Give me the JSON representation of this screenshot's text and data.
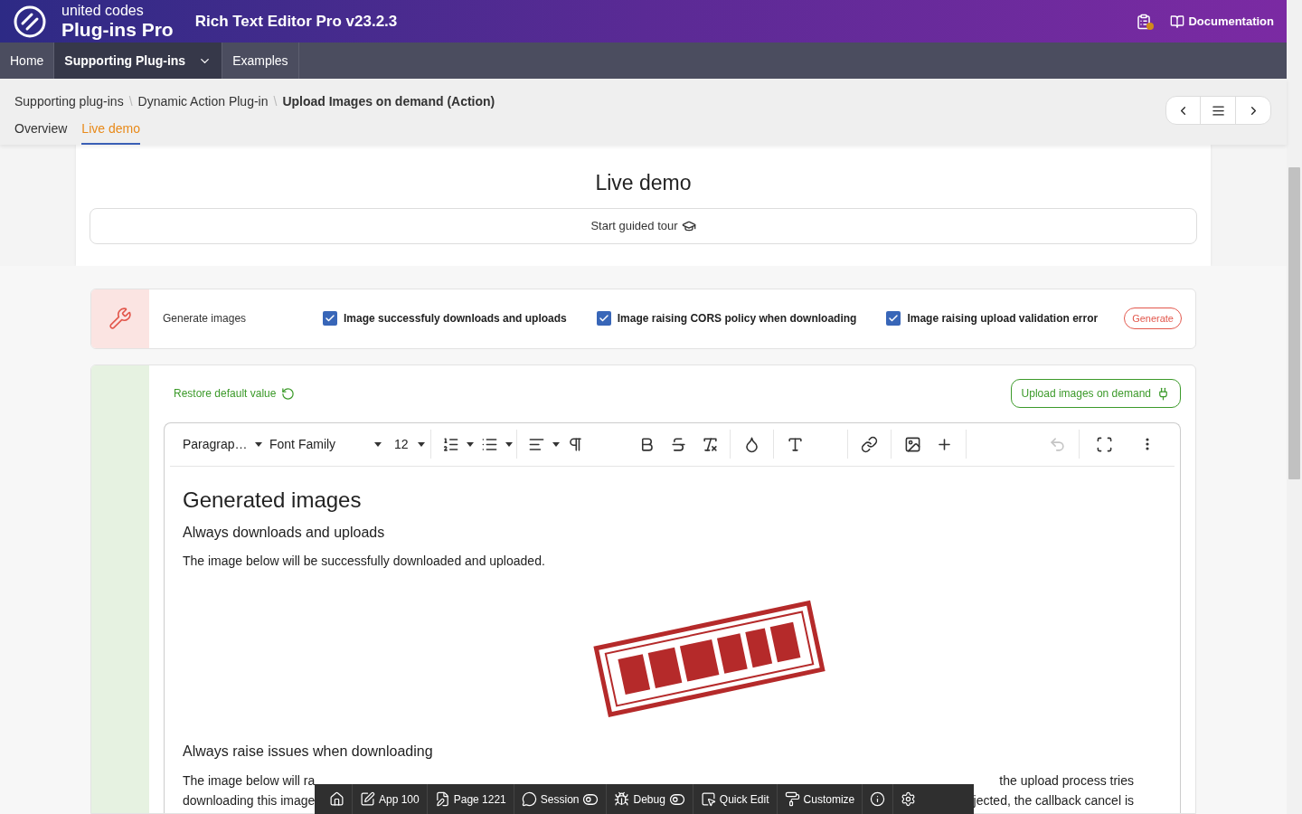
{
  "header": {
    "brand_top": "united codes",
    "brand_bottom": "Plug-ins Pro",
    "title": "Rich Text Editor Pro v23.2.3",
    "doc_link": "Documentation"
  },
  "nav": [
    {
      "label": "Home",
      "selected": false,
      "dropdown": false
    },
    {
      "label": "Supporting Plug-ins",
      "selected": true,
      "dropdown": true
    },
    {
      "label": "Examples",
      "selected": false,
      "dropdown": false
    }
  ],
  "breadcrumb": {
    "separator": "\\",
    "items": [
      "Supporting plug-ins",
      "Dynamic Action Plug-in",
      "Upload Images on demand (Action)"
    ]
  },
  "tabs": [
    {
      "label": "Overview",
      "selected": false
    },
    {
      "label": "Live demo",
      "selected": true
    }
  ],
  "page_title": "Live demo",
  "tour_button": "Start guided tour",
  "generate_panel": {
    "label": "Generate images",
    "button": "Generate",
    "options": [
      {
        "label": "Image successfuly downloads and uploads",
        "checked": true
      },
      {
        "label": "Image raising CORS policy when downloading",
        "checked": true
      },
      {
        "label": "Image raising upload validation error",
        "checked": true
      }
    ]
  },
  "editor_panel": {
    "restore": "Restore default value",
    "upload_button": "Upload images on demand",
    "toolbar": {
      "block_format": "Paragrap…",
      "font_family": "Font Family",
      "font_size": "12",
      "undo_disabled": true
    },
    "content": [
      {
        "kind": "h1",
        "text": "Generated images"
      },
      {
        "kind": "h2",
        "text": "Always downloads and uploads"
      },
      {
        "kind": "p",
        "text": "The image below will be successfully downloaded and uploaded."
      },
      {
        "kind": "picture"
      },
      {
        "kind": "h2",
        "text": "Always raise issues when downloading"
      },
      {
        "kind": "split",
        "lines": [
          [
            "The image below will ra",
            "the upload process tries"
          ],
          [
            "downloading this image",
            "jected, the callback cancel is"
          ]
        ]
      }
    ]
  },
  "dev_toolbar": [
    {
      "kind": "home"
    },
    {
      "kind": "app",
      "label": "App 100"
    },
    {
      "kind": "page",
      "label": "Page 1221"
    },
    {
      "kind": "session",
      "label": "Session"
    },
    {
      "kind": "debug",
      "label": "Debug"
    },
    {
      "kind": "quick_edit",
      "label": "Quick Edit"
    },
    {
      "kind": "customize",
      "label": "Customize"
    },
    {
      "kind": "info"
    },
    {
      "kind": "settings"
    }
  ]
}
